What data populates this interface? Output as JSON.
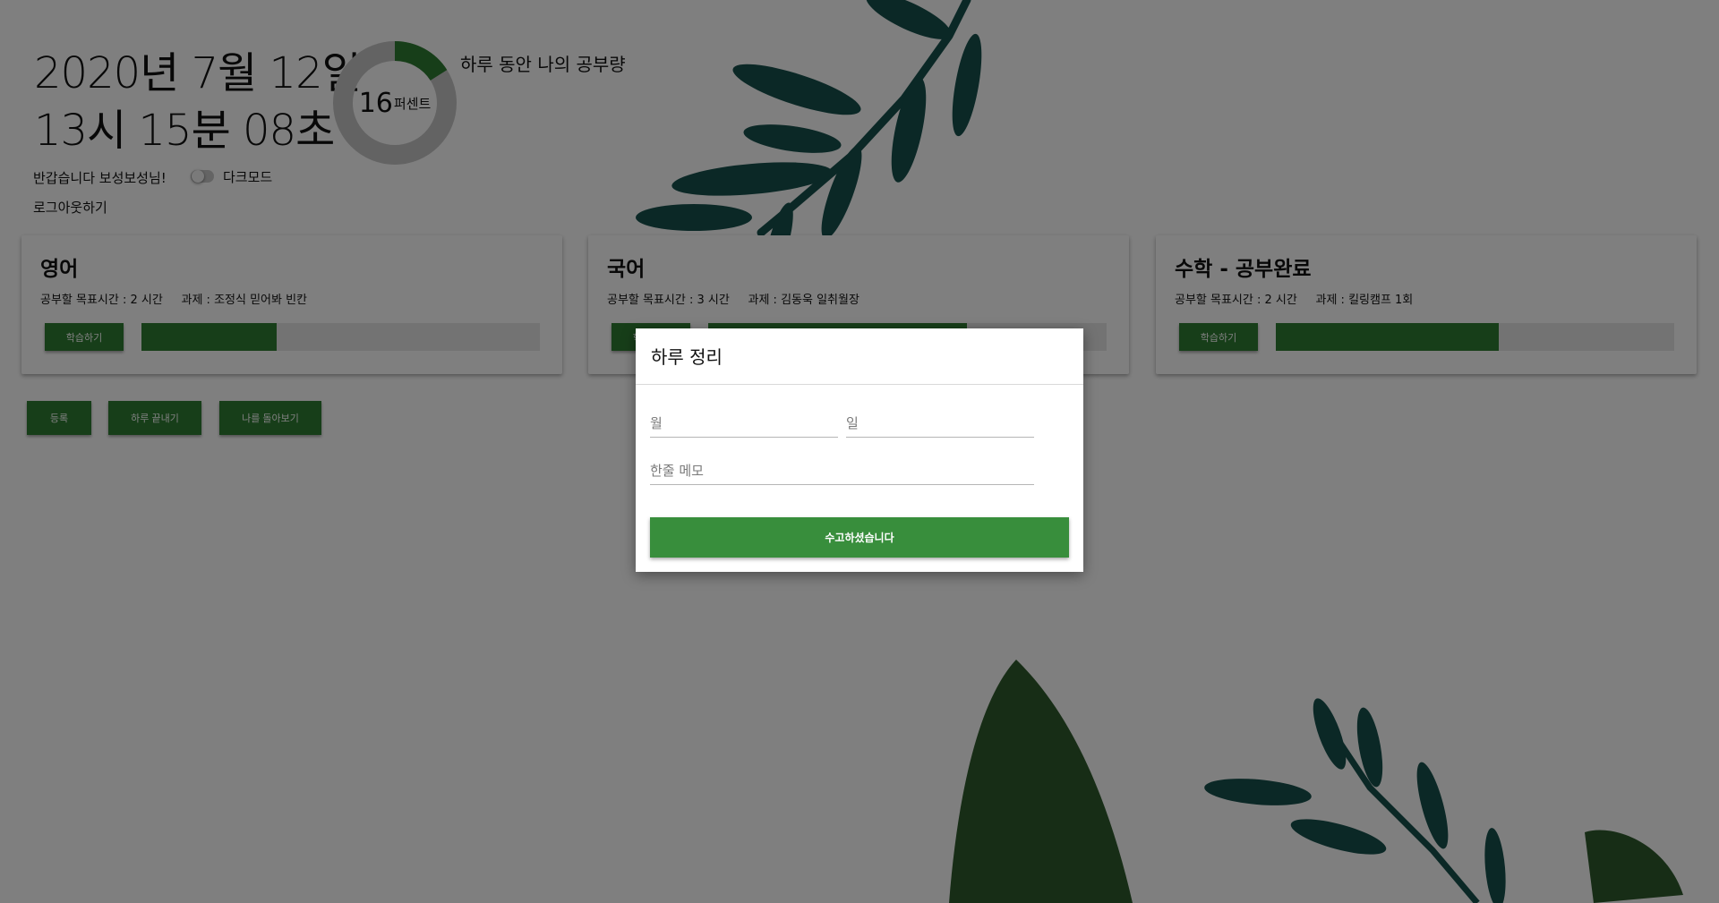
{
  "clock": {
    "date": "2020년 7월 12일",
    "time": "13시 15분 08초"
  },
  "progress": {
    "percent_value": "16",
    "unit": "퍼센트",
    "title": "하루 동안 나의 공부량",
    "fraction": 0.16,
    "fill_color": "#2e7d32",
    "track_color": "#c6c6c6"
  },
  "user": {
    "greeting": "반갑습니다 보성보성님!",
    "dark_mode_label": "다크모드",
    "dark_mode_on": false,
    "logout_label": "로그아웃하기"
  },
  "subjects": [
    {
      "title": "영어",
      "goal": "공부할 목표시간 : 2 시간",
      "task": "과제 : 조정식 믿어봐 빈칸",
      "button": "학습하기",
      "progress": 0.34
    },
    {
      "title": "국어",
      "goal": "공부할 목표시간 : 3 시간",
      "task": "과제 : 김동욱 일취월장",
      "button": "학습하기",
      "progress": 0.65
    },
    {
      "title": "수학 - 공부완료",
      "goal": "공부할 목표시간 : 2 시간",
      "task": "과제 : 킬링캠프 1회",
      "button": "학습하기",
      "progress": 0.56
    }
  ],
  "actions": {
    "register": "등록",
    "finish_day": "하루 끝내기",
    "look_back": "나를 돌아보기"
  },
  "modal": {
    "title": "하루 정리",
    "month_placeholder": "월",
    "day_placeholder": "일",
    "memo_placeholder": "한줄 메모",
    "submit_label": "수고하셨습니다"
  },
  "colors": {
    "accent": "#2e7d32",
    "leaf_dark": "#16504d",
    "leaf_green": "#2f5a2c"
  }
}
